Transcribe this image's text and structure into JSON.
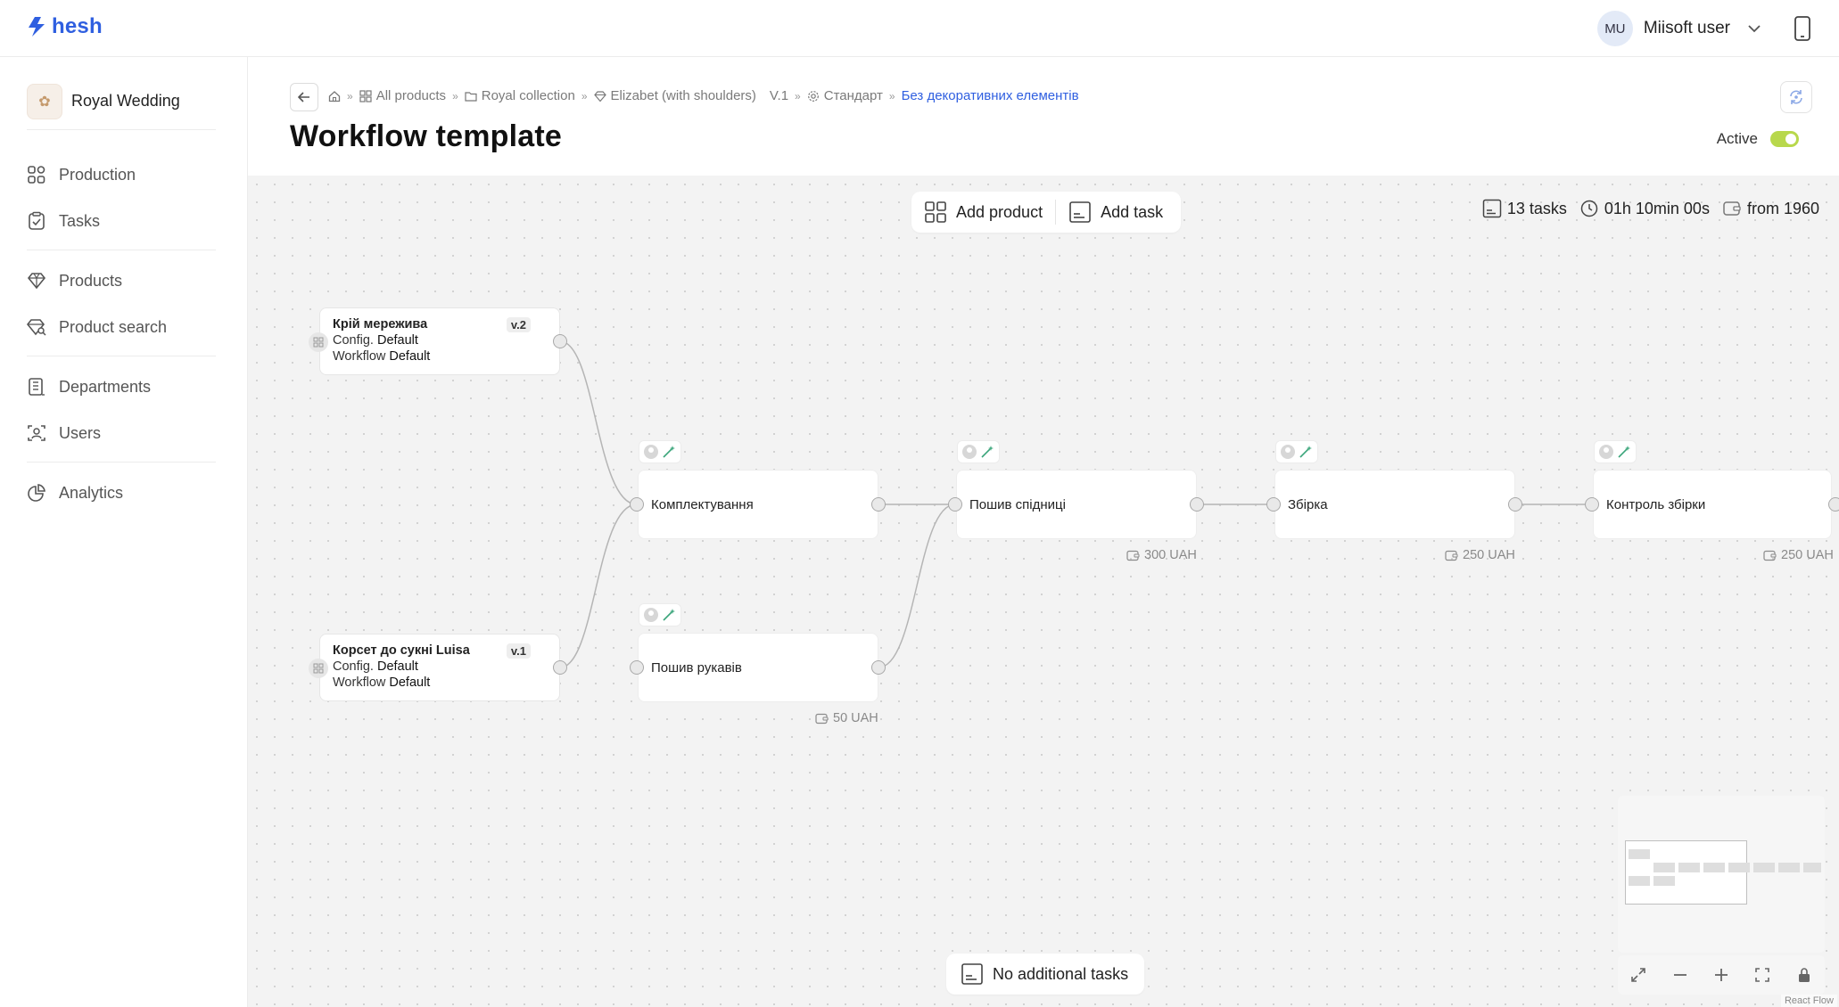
{
  "app": {
    "logo_text": "hesh"
  },
  "user": {
    "initials": "MU",
    "name": "Miisoft user"
  },
  "sidebar": {
    "org_name": "Royal Wedding",
    "items": [
      {
        "label": "Production",
        "icon": "production-icon"
      },
      {
        "label": "Tasks",
        "icon": "tasks-icon"
      },
      {
        "label": "Products",
        "icon": "diamond-icon"
      },
      {
        "label": "Product search",
        "icon": "diamond-search-icon"
      },
      {
        "label": "Departments",
        "icon": "building-icon"
      },
      {
        "label": "Users",
        "icon": "user-scan-icon"
      },
      {
        "label": "Analytics",
        "icon": "pie-chart-icon"
      }
    ]
  },
  "breadcrumbs": {
    "all_products": "All products",
    "collection": "Royal collection",
    "product": "Elizabet (with shoulders)",
    "version": "V.1",
    "config": "Стандарт",
    "current": "Без декоративних елементів"
  },
  "page": {
    "title": "Workflow template",
    "active_label": "Active",
    "active": true
  },
  "toolbar": {
    "add_product": "Add product",
    "add_task": "Add task"
  },
  "stats": {
    "tasks": "13 tasks",
    "duration": "01h 10min 00s",
    "cost": "from 1960"
  },
  "products": [
    {
      "title": "Крій мережива",
      "version": "v.2",
      "config_label": "Config.",
      "config_value": "Default",
      "workflow_label": "Workflow",
      "workflow_value": "Default"
    },
    {
      "title": "Корсет до сукні Luisa",
      "version": "v.1",
      "config_label": "Config.",
      "config_value": "Default",
      "workflow_label": "Workflow",
      "workflow_value": "Default"
    }
  ],
  "tasks": [
    {
      "label": "Комплектування",
      "price": ""
    },
    {
      "label": "Пошив спідниці",
      "price": "300 UAH"
    },
    {
      "label": "Збірка",
      "price": "250 UAH"
    },
    {
      "label": "Контроль збірки",
      "price": "250 UAH"
    },
    {
      "label": "Пошив рукавів",
      "price": "50 UAH"
    }
  ],
  "footer": {
    "no_tasks": "No additional tasks",
    "attribution": "React Flow"
  },
  "colors": {
    "accent": "#2f5fe0",
    "toggle": "#b8d84c",
    "canvas": "#f3f3f3",
    "wand": "#3aa57a"
  }
}
